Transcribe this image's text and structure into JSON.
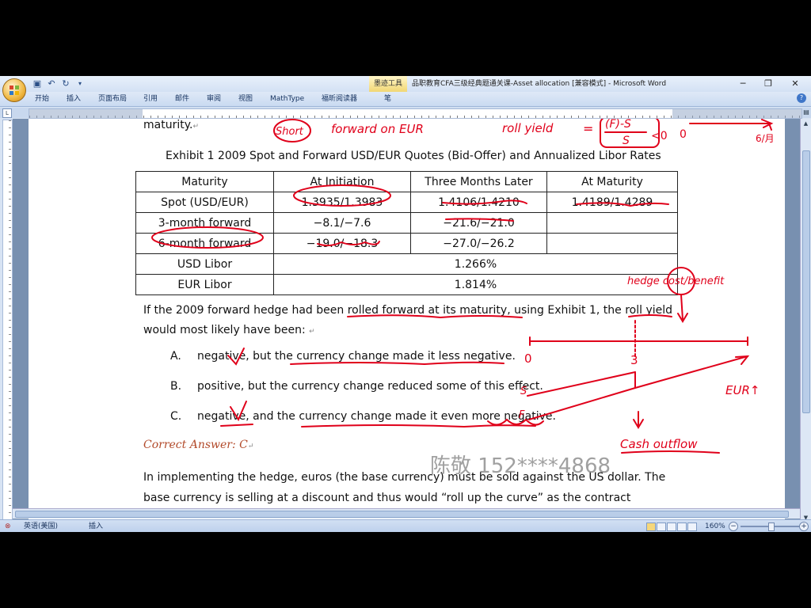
{
  "titlebar": {
    "tool_tab": "墨迹工具",
    "title": "品职教育CFA三级经典题通关课-Asset allocation [兼容模式] - Microsoft Word"
  },
  "ribbon": {
    "tabs": [
      "开始",
      "插入",
      "页面布局",
      "引用",
      "邮件",
      "审阅",
      "视图",
      "MathType",
      "福昕阅读器",
      "笔"
    ]
  },
  "document": {
    "top_line": "maturity.",
    "exhibit_title": "Exhibit 1 2009 Spot and Forward USD/EUR Quotes (Bid-Offer) and Annualized Libor Rates",
    "table": {
      "headers": [
        "Maturity",
        "At Initiation",
        "Three Months Later",
        "At Maturity"
      ],
      "rows": [
        [
          "Spot (USD/EUR)",
          "1.3935/1.3983",
          "1.4106/1.4210",
          "1.4189/1.4289"
        ],
        [
          "3-month forward",
          "−8.1/−7.6",
          "−21.6/−21.0",
          ""
        ],
        [
          "6-month forward",
          "−19.0/−18.3",
          "−27.0/−26.2",
          ""
        ]
      ],
      "libor_rows": [
        [
          "USD Libor",
          "1.266%"
        ],
        [
          "EUR Libor",
          "1.814%"
        ]
      ]
    },
    "question_line1": "If the 2009 forward hedge had been rolled forward at its maturity, using Exhibit 1, the roll yield",
    "question_line2": "would most likely have been:",
    "options": [
      {
        "letter": "A.",
        "text": "negative, but the currency change made it less negative."
      },
      {
        "letter": "B.",
        "text": "positive, but the currency change reduced some of this effect."
      },
      {
        "letter": "C.",
        "text": "negative, and the currency change made it even more negative."
      }
    ],
    "answer": "Correct Answer: C",
    "explanation_line1": "In implementing the hedge, euros (the base currency) must be sold against the US dollar. The",
    "explanation_line2": "base currency is selling at a discount and thus would “roll up the curve” as the contract",
    "watermark": "陈敬 152****4868"
  },
  "annotations": {
    "short_label": "Short",
    "forward_note": "forward on EUR",
    "roll_yield_label": "roll yield",
    "eq_numerator": "(F)-S",
    "eq_denominator": "S",
    "eq_tail": "<0",
    "eq_zero": "0",
    "side_number": "6/月",
    "hedge_note": "hedge cost/benefit",
    "point_zero": "0",
    "point_three": "3",
    "eur_note": "EUR↑",
    "S_mark": "S",
    "F_mark": "F",
    "cash_note": "Cash outflow",
    "ink_color": "#e0001a"
  },
  "statusbar": {
    "language": "英语(美国)",
    "mode": "插入",
    "zoom": "160%"
  }
}
